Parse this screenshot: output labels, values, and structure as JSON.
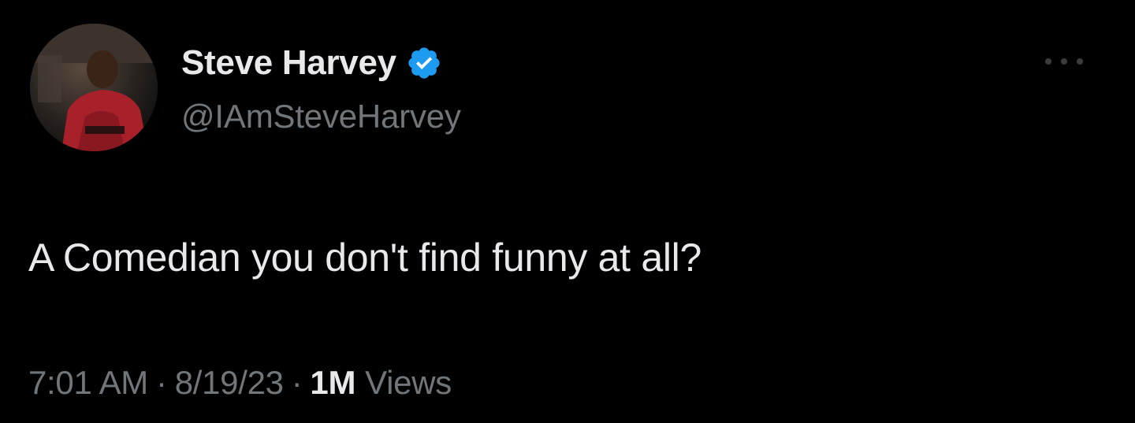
{
  "tweet": {
    "author": {
      "display_name": "Steve Harvey",
      "handle": "@IAmSteveHarvey",
      "verified": true,
      "avatar_icon": "profile-photo"
    },
    "text": "A Comedian you don't find funny at all?",
    "time": "7:01 AM",
    "date": "8/19/23",
    "separator": "·",
    "views_count": "1M",
    "views_label": "Views",
    "more_icon": "ellipsis-icon"
  },
  "colors": {
    "background": "#000000",
    "primary_text": "#e7e9ea",
    "secondary_text": "#71767b",
    "verified_blue": "#1d9bf0"
  }
}
